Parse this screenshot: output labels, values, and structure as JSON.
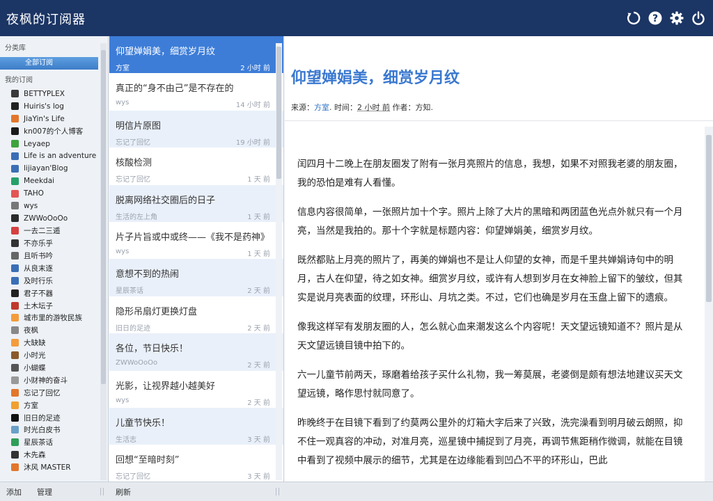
{
  "app": {
    "title": "夜枫的订阅器"
  },
  "sidebar": {
    "category_heading": "分类库",
    "all_label": "全部订阅",
    "my_heading": "我的订阅",
    "feeds": [
      {
        "label": "BETTYPLEX",
        "color": "#3a3a3a"
      },
      {
        "label": "Huiris's log",
        "color": "#222222"
      },
      {
        "label": "JiaYin's Life",
        "color": "#e2762b"
      },
      {
        "label": "kn007的个人博客",
        "color": "#1a1a1a"
      },
      {
        "label": "Leyaep",
        "color": "#3da33d"
      },
      {
        "label": "Life is an adventure",
        "color": "#3a6fb5"
      },
      {
        "label": "lijiayan'Blog",
        "color": "#3a6fb5"
      },
      {
        "label": "Meekdai",
        "color": "#25a06b"
      },
      {
        "label": "TAHO",
        "color": "#e25555"
      },
      {
        "label": "wys",
        "color": "#777777"
      },
      {
        "label": "ZWWoOoOo",
        "color": "#2b2b2b"
      },
      {
        "label": "一去二三遁",
        "color": "#d64040"
      },
      {
        "label": "不亦乐乎",
        "color": "#333333"
      },
      {
        "label": "且听书吟",
        "color": "#666666"
      },
      {
        "label": "从良末逐",
        "color": "#3a6fb5"
      },
      {
        "label": "及时行乐",
        "color": "#3a6fb5"
      },
      {
        "label": "君子不器",
        "color": "#222222"
      },
      {
        "label": "土木坛子",
        "color": "#c0392b"
      },
      {
        "label": "城市里的游牧民族",
        "color": "#f39c3c"
      },
      {
        "label": "夜枫",
        "color": "#888888"
      },
      {
        "label": "大缺缺",
        "color": "#f39c3c"
      },
      {
        "label": "小时光",
        "color": "#8a5a2b"
      },
      {
        "label": "小蝴蝶",
        "color": "#555555"
      },
      {
        "label": "小财神的奋斗",
        "color": "#999999"
      },
      {
        "label": "忘记了回忆",
        "color": "#e2762b"
      },
      {
        "label": "方室",
        "color": "#f0a030"
      },
      {
        "label": "旧日的足迹",
        "color": "#111111"
      },
      {
        "label": "时光白皮书",
        "color": "#6aa0c8"
      },
      {
        "label": "星辰茶话",
        "color": "#2f9e5a"
      },
      {
        "label": "木先森",
        "color": "#333333"
      },
      {
        "label": "沐风 MASTER",
        "color": "#e2762b"
      }
    ]
  },
  "articles": [
    {
      "title": "仰望婵娟美，细赏岁月纹",
      "source": "方室",
      "time": "2 小时 前"
    },
    {
      "title": "真正的“身不由己”是不存在的",
      "source": "wys",
      "time": "14 小时 前"
    },
    {
      "title": "明信片原图",
      "source": "忘记了回忆",
      "time": "19 小时 前"
    },
    {
      "title": "核酸检测",
      "source": "忘记了回忆",
      "time": "1 天 前"
    },
    {
      "title": "脱离网络社交圈后的日子",
      "source": "生活的左上角",
      "time": "1 天 前"
    },
    {
      "title": "片子片旨或中或终——《我不是药神》",
      "source": "wys",
      "time": "1 天 前"
    },
    {
      "title": "意想不到的热闹",
      "source": "星辰茶话",
      "time": "2 天 前"
    },
    {
      "title": "隐形吊扇灯更换灯盘",
      "source": "旧日的足迹",
      "time": "2 天 前"
    },
    {
      "title": "各位，节日快乐！",
      "source": "ZWWoOoOo",
      "time": "2 天 前"
    },
    {
      "title": "光影，让视界越小越美好",
      "source": "wys",
      "time": "2 天 前"
    },
    {
      "title": "儿童节快乐！",
      "source": "生活志",
      "time": "3 天 前"
    },
    {
      "title": "回想“至暗时刻”",
      "source": "忘记了回忆",
      "time": "3 天 前"
    }
  ],
  "reader": {
    "title": "仰望婵娟美，细赏岁月纹",
    "meta_source_label": "来源：",
    "meta_source": "方室",
    "meta_time_label": ". 时间：",
    "meta_time": "2 小时 前",
    "meta_author_label": " 作者：",
    "meta_author": "方知.",
    "paragraphs": [
      "闰四月十二晚上在朋友圈发了附有一张月亮照片的信息，我想，如果不对照我老婆的朋友圈，我的恐怕是难有人看懂。",
      "信息内容很简单，一张照片加十个字。照片上除了大片的黑暗和两团蓝色光点外就只有一个月亮，当然是我拍的。那十个字就是标题内容：仰望婵娟美，细赏岁月纹。",
      "既然都贴上月亮的照片了，再美的婵娟也不是让人仰望的女神，而是千里共婵娟诗句中的明月，古人在仰望，待之如女神。细赏岁月纹，或许有人想到岁月在女神脸上留下的皱纹，但其实是说月亮表面的纹理，环形山、月坑之类。不过，它们也确是岁月在玉盘上留下的遗痕。",
      "像我这样罕有发朋友圈的人，怎么就心血来潮发这么个内容呢！天文望远镜知道不？照片是从天文望远镜目镜中拍下的。",
      "六一儿童节前两天，琢磨着给孩子买什么礼物，我一筹莫展，老婆倒是颇有想法地建议买天文望远镜，略作思忖就同意了。",
      "昨晚终于在目镜下看到了约莫两公里外的灯箱大字后来了兴致，洗完澡看到明月破云朗照，抑不住一观真容的冲动，对准月亮，巡星镜中捕捉到了月亮，再调节焦距稍作微调，就能在目镜中看到了视频中展示的细节，尤其是在边缘能看到凹凸不平的环形山，巴此"
    ]
  },
  "footer": {
    "add_label": "添加",
    "manage_label": "管理",
    "refresh_label": "刷新"
  }
}
